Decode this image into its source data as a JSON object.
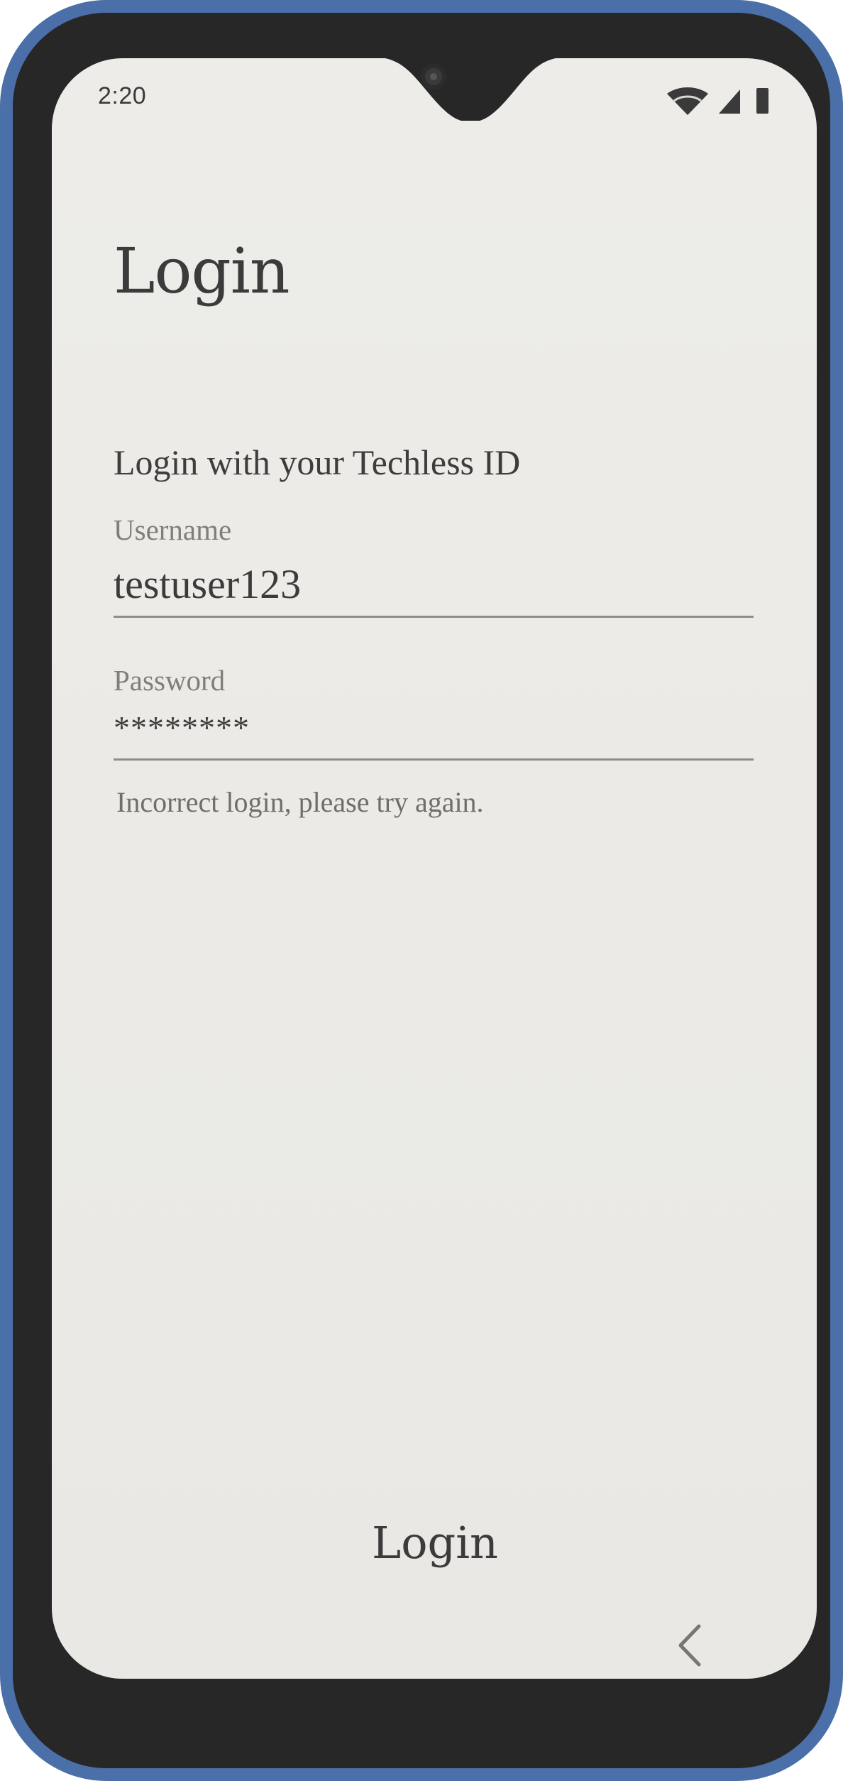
{
  "status_bar": {
    "time": "2:20",
    "icons": [
      "wifi-icon",
      "signal-icon",
      "battery-icon"
    ]
  },
  "page": {
    "title": "Login",
    "subtitle": "Login with your Techless ID"
  },
  "form": {
    "username_label": "Username",
    "username_value": "testuser123",
    "password_label": "Password",
    "password_value": "********",
    "error_message": "Incorrect login, please try again."
  },
  "actions": {
    "login_label": "Login"
  },
  "nav": {
    "back_icon": "chevron-left-icon"
  },
  "colors": {
    "frame": "#4b6fa8",
    "bezel": "#272727",
    "screen_bg": "#ecebe7",
    "text": "#3b3b3b",
    "label": "#7f7e7b"
  }
}
